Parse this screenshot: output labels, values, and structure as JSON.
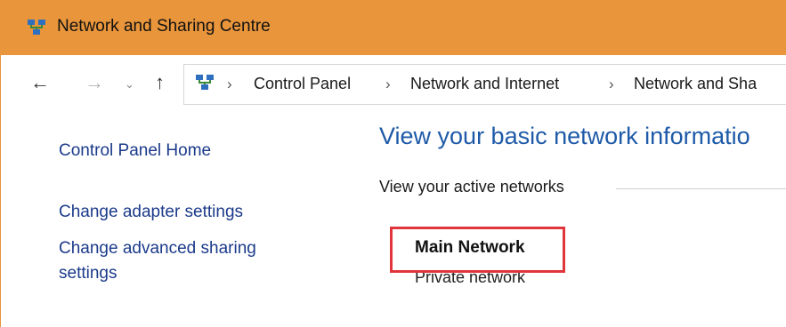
{
  "window": {
    "title": "Network and Sharing Centre",
    "icon": "network-icon"
  },
  "address_bar": {
    "icon": "network-icon",
    "breadcrumbs": [
      "Control Panel",
      "Network and Internet",
      "Network and Sha"
    ],
    "nav": {
      "back": "←",
      "forward": "→",
      "recent": "⌄",
      "up": "↑",
      "separator": "›"
    }
  },
  "sidebar": {
    "items": [
      {
        "label": "Control Panel Home"
      },
      {
        "label": "Change adapter settings"
      },
      {
        "label": "Change advanced sharing",
        "label2": "settings"
      }
    ]
  },
  "main": {
    "title": "View your basic network informatio",
    "active_networks_label": "View your active networks",
    "network": {
      "name": "Main Network",
      "type": "Private network"
    }
  },
  "colors": {
    "titlebar": "#e8953b",
    "link": "#1b3a8a",
    "title": "#1e5aa8",
    "highlight": "#e0353b"
  }
}
